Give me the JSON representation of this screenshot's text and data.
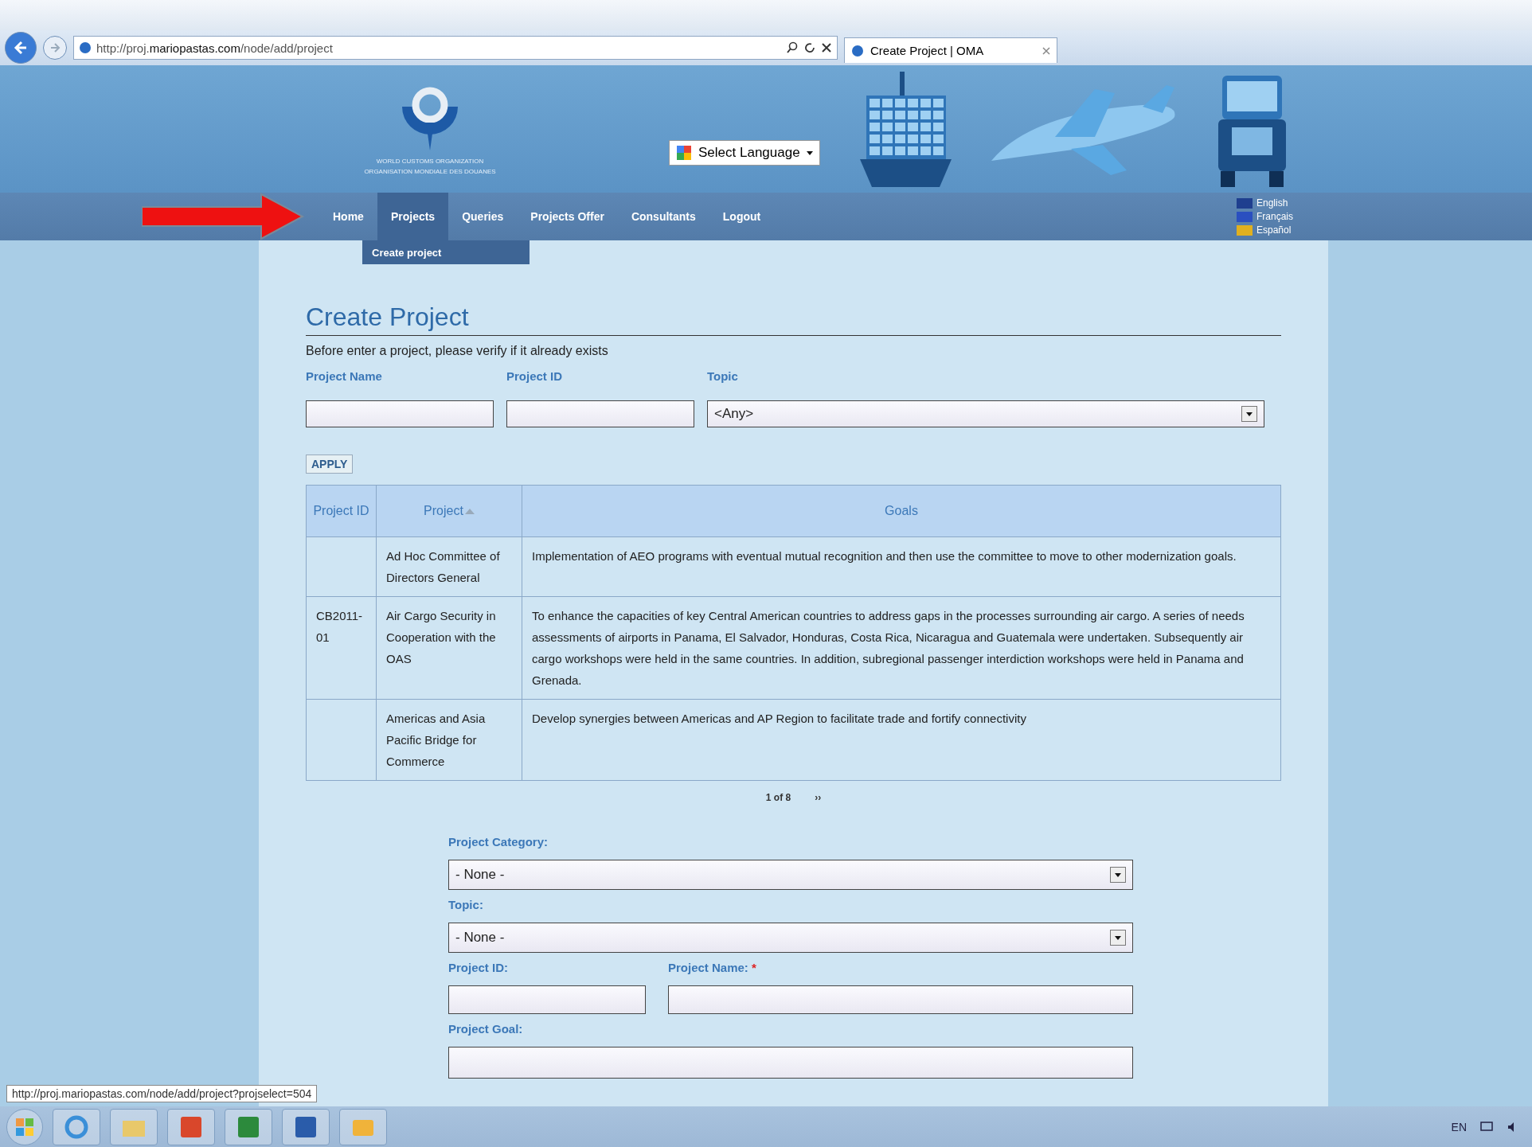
{
  "browser": {
    "address": "http://proj.**mariopastas.com**/node/add/project",
    "tabs": [
      {
        "label": "Create Project | OMA",
        "selected": true
      }
    ]
  },
  "header": {
    "logo_lines": [
      "WORLD CUSTOMS ORGANIZATION",
      "ORGANISATION MONDIALE DES DOUANES"
    ],
    "language_select": "Select Language"
  },
  "nav": {
    "items": [
      {
        "label": "Home",
        "selected": false
      },
      {
        "label": "Projects",
        "selected": true
      },
      {
        "label": "Queries",
        "selected": false
      },
      {
        "label": "Projects Offer",
        "selected": false
      },
      {
        "label": "Consultants",
        "selected": false
      },
      {
        "label": "Logout",
        "selected": false
      }
    ],
    "submenu": [
      "Create project"
    ],
    "languages": [
      {
        "label": "English",
        "color": "#1f3f8f"
      },
      {
        "label": "Français",
        "color": "#2a4fc0"
      },
      {
        "label": "Español",
        "color": "#e0b020"
      }
    ]
  },
  "page": {
    "title": "Create Project",
    "intro": "Before enter a project, please verify if it already exists",
    "filters": [
      {
        "label": "Project Name",
        "kind": "text"
      },
      {
        "label": "Project ID",
        "kind": "text"
      },
      {
        "label": "Topic",
        "kind": "select",
        "value": "<Any>"
      }
    ],
    "apply": "APPLY",
    "table": {
      "columns": [
        {
          "label": "Project ID",
          "sorted": false
        },
        {
          "label": "Project",
          "sorted": true
        },
        {
          "label": "Goals",
          "sorted": false
        }
      ],
      "rows": [
        {
          "id": "",
          "project": "Ad Hoc Committee of Directors General",
          "goals": "Implementation of AEO programs with eventual mutual recognition and then use the committee to move to other modernization goals."
        },
        {
          "id": "CB2011-01",
          "project": "Air Cargo Security in Cooperation with the OAS",
          "goals": "To enhance the capacities of key Central American countries to address gaps in the processes surrounding air cargo. A series of needs assessments of airports in Panama, El Salvador, Honduras, Costa Rica, Nicaragua and Guatemala were undertaken. Subsequently air cargo workshops were held in the same countries. In addition, subregional passenger interdiction workshops were held in Panama and Grenada."
        },
        {
          "id": "",
          "project": "Americas and Asia Pacific Bridge for Commerce",
          "goals": "Develop synergies between Americas and AP Region to facilitate trade and fortify connectivity"
        }
      ]
    },
    "pager": {
      "label": "1 of 8",
      "next": "››"
    },
    "form": [
      {
        "kind": "select",
        "label": "Project Category:",
        "value": "- None -"
      },
      {
        "kind": "select",
        "label": "Topic:",
        "value": "- None -"
      },
      {
        "kind": "pair",
        "fields": [
          {
            "label": "Project ID:"
          },
          {
            "label": "Project Name:",
            "required_mark": "*"
          }
        ]
      },
      {
        "kind": "textarea",
        "label": "Project Goal:"
      }
    ]
  },
  "status_url": "http://proj.mariopastas.com/node/add/project?projselect=504",
  "taskbar": {
    "language": "EN"
  }
}
